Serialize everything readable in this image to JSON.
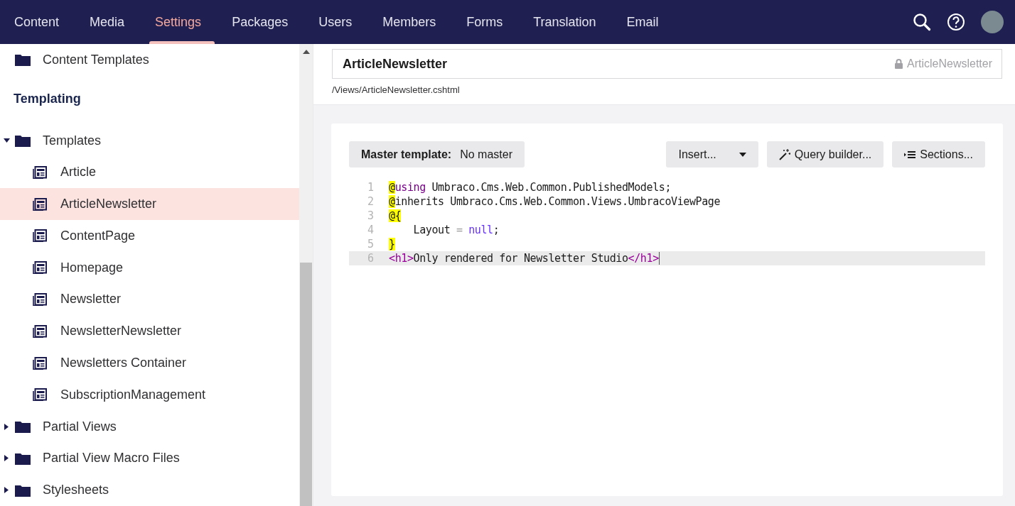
{
  "nav": {
    "sections": [
      {
        "label": "Content",
        "selected": false
      },
      {
        "label": "Media",
        "selected": false
      },
      {
        "label": "Settings",
        "selected": true
      },
      {
        "label": "Packages",
        "selected": false
      },
      {
        "label": "Users",
        "selected": false
      },
      {
        "label": "Members",
        "selected": false
      },
      {
        "label": "Forms",
        "selected": false
      },
      {
        "label": "Translation",
        "selected": false
      },
      {
        "label": "Email",
        "selected": false
      }
    ]
  },
  "sidebar": {
    "items": [
      {
        "kind": "folder",
        "label": "Content Templates",
        "selected": false
      },
      {
        "kind": "heading",
        "label": "Templating"
      },
      {
        "kind": "folder",
        "label": "Templates",
        "expanded": true,
        "selected": false,
        "children": [
          {
            "kind": "template",
            "label": "Article",
            "selected": false
          },
          {
            "kind": "template",
            "label": "ArticleNewsletter",
            "selected": true
          },
          {
            "kind": "template",
            "label": "ContentPage",
            "selected": false
          },
          {
            "kind": "template",
            "label": "Homepage",
            "selected": false
          },
          {
            "kind": "template",
            "label": "Newsletter",
            "selected": false
          },
          {
            "kind": "template",
            "label": "NewsletterNewsletter",
            "selected": false
          },
          {
            "kind": "template",
            "label": "Newsletters Container",
            "selected": false
          },
          {
            "kind": "template",
            "label": "SubscriptionManagement",
            "selected": false
          }
        ]
      },
      {
        "kind": "folder",
        "label": "Partial Views",
        "expanded": false,
        "selected": false
      },
      {
        "kind": "folder",
        "label": "Partial View Macro Files",
        "expanded": false,
        "selected": false
      },
      {
        "kind": "folder",
        "label": "Stylesheets",
        "expanded": false,
        "selected": false
      }
    ]
  },
  "editor": {
    "name": "ArticleNewsletter",
    "alias": "ArticleNewsletter",
    "path": "/Views/ArticleNewsletter.cshtml",
    "master_label": "Master template:",
    "master_value": "No master",
    "buttons": [
      {
        "kind": "dropdown",
        "label": "Insert..."
      },
      {
        "kind": "wand",
        "label": "Query builder..."
      },
      {
        "kind": "sections",
        "label": "Sections..."
      }
    ],
    "code": [
      {
        "number": "1",
        "current": false,
        "tokens": [
          {
            "kind": "at",
            "text": "@"
          },
          {
            "kind": "keyword",
            "text": "using"
          },
          {
            "kind": "plain",
            "text": " Umbraco.Cms.Web.Common.PublishedModels;"
          }
        ]
      },
      {
        "number": "2",
        "current": false,
        "tokens": [
          {
            "kind": "at",
            "text": "@"
          },
          {
            "kind": "plain",
            "text": "inherits Umbraco.Cms.Web.Common.Views.UmbracoViewPage"
          }
        ]
      },
      {
        "number": "3",
        "current": false,
        "tokens": [
          {
            "kind": "at",
            "text": "@{"
          }
        ]
      },
      {
        "number": "4",
        "current": false,
        "tokens": [
          {
            "kind": "plain",
            "text": "    Layout "
          },
          {
            "kind": "operator",
            "text": "="
          },
          {
            "kind": "atom",
            "text": " null"
          },
          {
            "kind": "plain",
            "text": ";"
          }
        ]
      },
      {
        "number": "5",
        "current": false,
        "tokens": [
          {
            "kind": "at",
            "text": "}"
          }
        ]
      },
      {
        "number": "6",
        "current": true,
        "tokens": [
          {
            "kind": "tag",
            "text": "<h1>"
          },
          {
            "kind": "plain",
            "text": "Only rendered for Newsletter Studio"
          },
          {
            "kind": "tag",
            "text": "</h1>"
          }
        ]
      }
    ]
  }
}
